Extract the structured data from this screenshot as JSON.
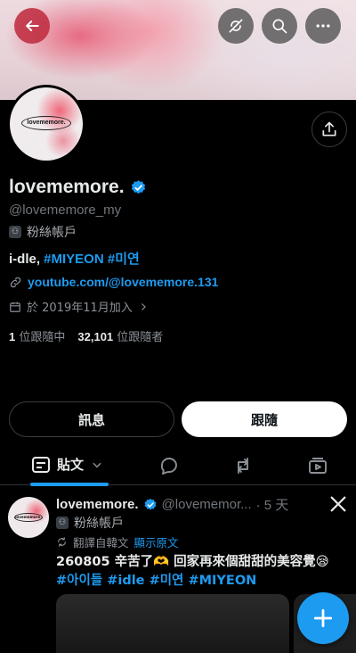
{
  "profile": {
    "display_name": "lovememore.",
    "handle": "@lovememore_my",
    "account_type": "粉絲帳戶",
    "bio_prefix": "i-dle, ",
    "bio_tag1": "#MIYEON",
    "bio_tag2": "#미연",
    "link": "youtube.com/@lovememore.131",
    "joined": "於 2019年11月加入",
    "following_count": "1",
    "following_label": "位跟隨中",
    "followers_count": "32,101",
    "followers_label": "位跟隨者",
    "avatar_logo_text": "lovememore."
  },
  "actions": {
    "message_label": "訊息",
    "follow_label": "跟隨"
  },
  "tabs": {
    "posts_label": "貼文"
  },
  "post": {
    "name": "lovememore.",
    "handle": "@lovememor...",
    "time": "· 5 天",
    "account_type": "粉絲帳戶",
    "translate_label": "翻譯自韓文",
    "show_original": "顯示原文",
    "text": "260805 辛苦了🫶 回家再來個甜甜的美容覺😪",
    "tags": "#아이들 #idle #미연 #MIYEON"
  },
  "colors": {
    "accent": "#1d9bf0",
    "background": "#000000",
    "text": "#e7e9ea",
    "muted": "#71767b"
  },
  "icons": [
    "back-arrow-icon",
    "sync-off-icon",
    "search-icon",
    "more-icon",
    "share-icon",
    "verified-badge-icon",
    "fan-account-icon",
    "link-icon",
    "calendar-icon",
    "posts-tab-icon",
    "reply-tab-icon",
    "repost-tab-icon",
    "media-tab-icon",
    "x-logo-icon",
    "translate-icon",
    "compose-plus-icon"
  ]
}
